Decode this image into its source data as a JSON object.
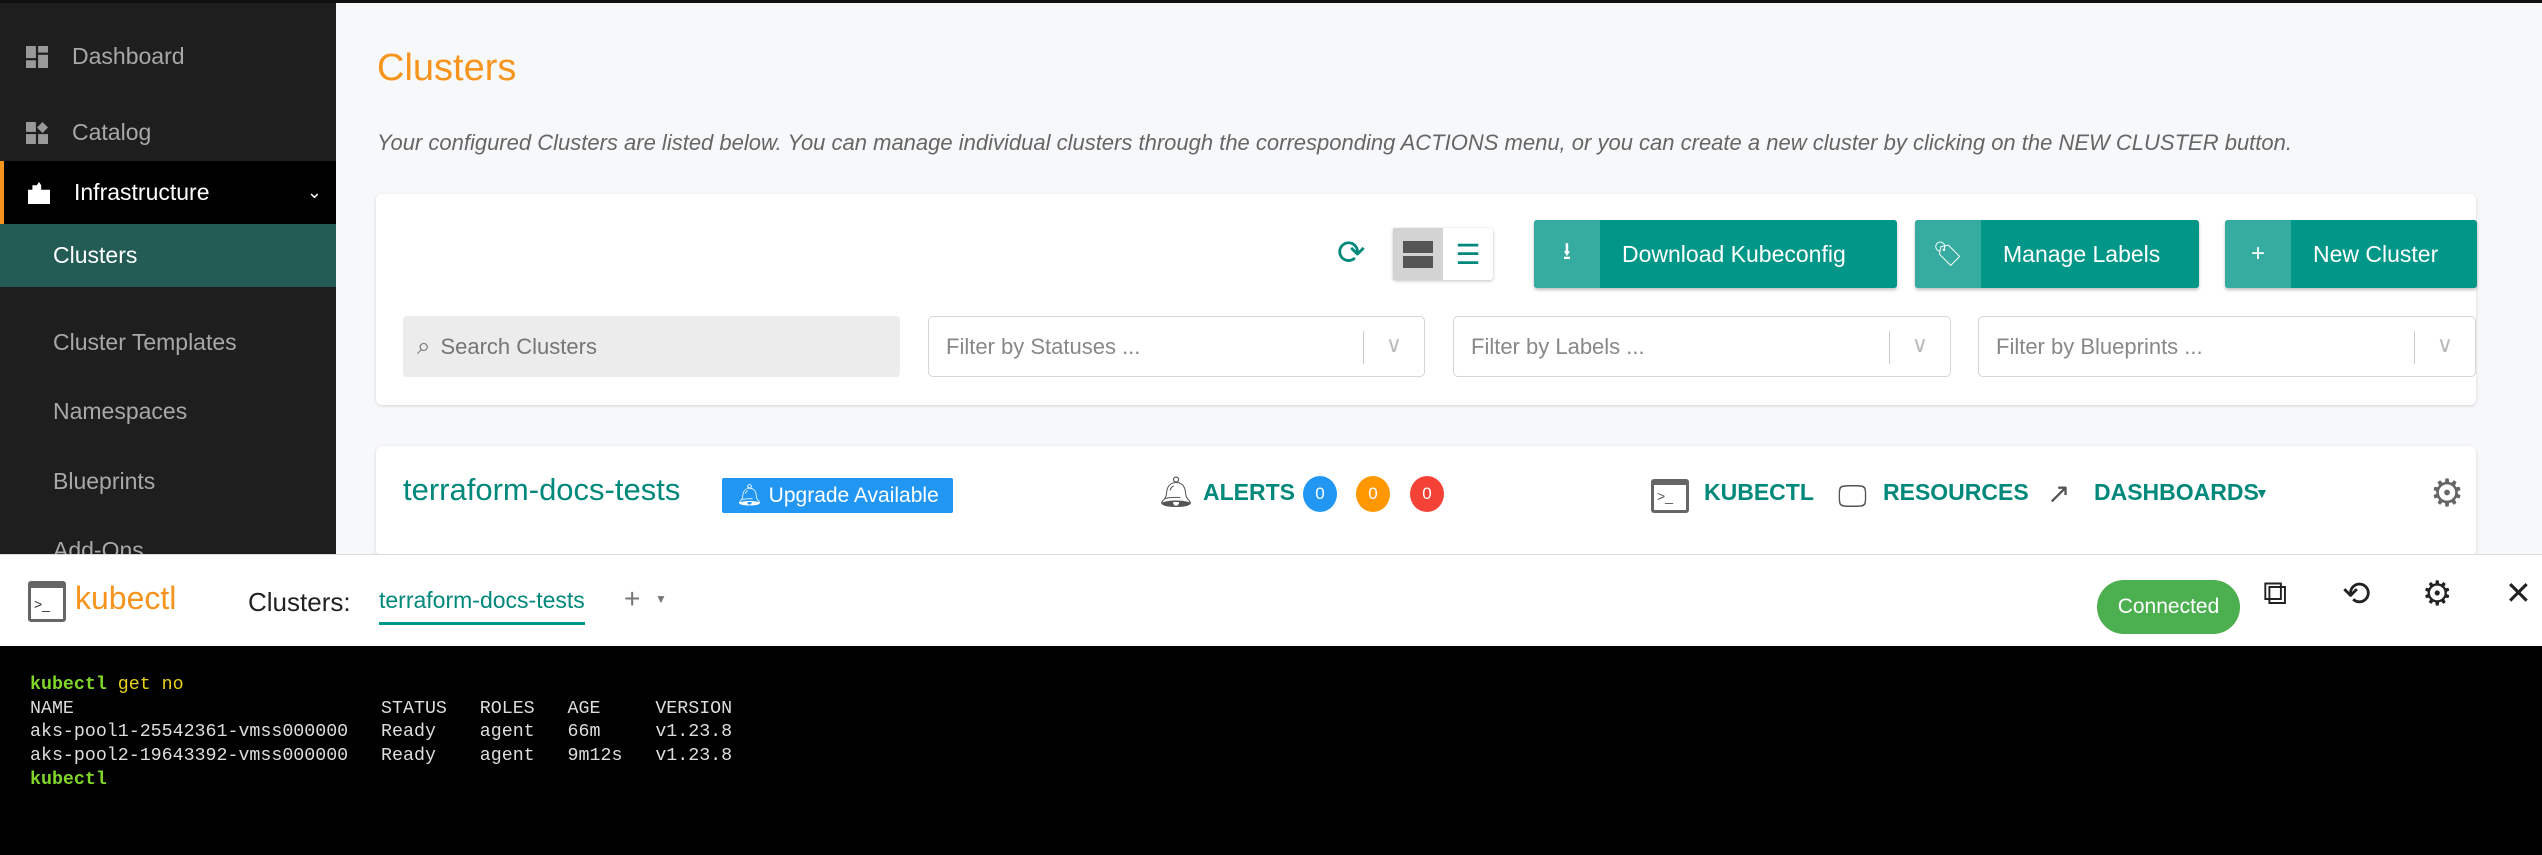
{
  "sidebar": {
    "items": [
      {
        "label": "Dashboard",
        "icon": "dashboard-icon"
      },
      {
        "label": "Catalog",
        "icon": "catalog-icon"
      },
      {
        "label": "Infrastructure",
        "icon": "building-icon",
        "expanded": true
      },
      {
        "label": "Clusters",
        "active": true
      },
      {
        "label": "Cluster Templates"
      },
      {
        "label": "Namespaces"
      },
      {
        "label": "Blueprints"
      },
      {
        "label": "Add-Ons"
      }
    ]
  },
  "page": {
    "title": "Clusters",
    "description": "Your configured Clusters are listed below. You can manage individual clusters through the corresponding ACTIONS menu, or you can create a new cluster by clicking on the NEW CLUSTER button."
  },
  "toolbar": {
    "download_label": "Download Kubeconfig",
    "labels_label": "Manage Labels",
    "new_label": "New Cluster"
  },
  "filters": {
    "search_placeholder": "Search Clusters",
    "statuses": "Filter by Statuses ...",
    "labels": "Filter by Labels ...",
    "blueprints": "Filter by Blueprints ..."
  },
  "cluster": {
    "name": "terraform-docs-tests",
    "badge": "Upgrade Available",
    "alerts_label": "ALERTS",
    "alert_counts": [
      "0",
      "0",
      "0"
    ],
    "kubectl": "KUBECTL",
    "resources": "RESOURCES",
    "dashboards": "DASHBOARDS"
  },
  "kubectl_bar": {
    "title": "kubectl",
    "clusters_label": "Clusters:",
    "active_tab": "terraform-docs-tests",
    "add": "+",
    "status": "Connected"
  },
  "terminal": {
    "prompt": "kubectl",
    "command": " get no",
    "header": "NAME                            STATUS   ROLES   AGE     VERSION",
    "rows": [
      "aks-pool1-25542361-vmss000000   Ready    agent   66m     v1.23.8",
      "aks-pool2-19643392-vmss000000   Ready    agent   9m12s   v1.23.8"
    ]
  },
  "colors": {
    "accent": "#f7941d",
    "teal": "#009688",
    "connected": "#4caf50",
    "badge": "#2196f3"
  }
}
